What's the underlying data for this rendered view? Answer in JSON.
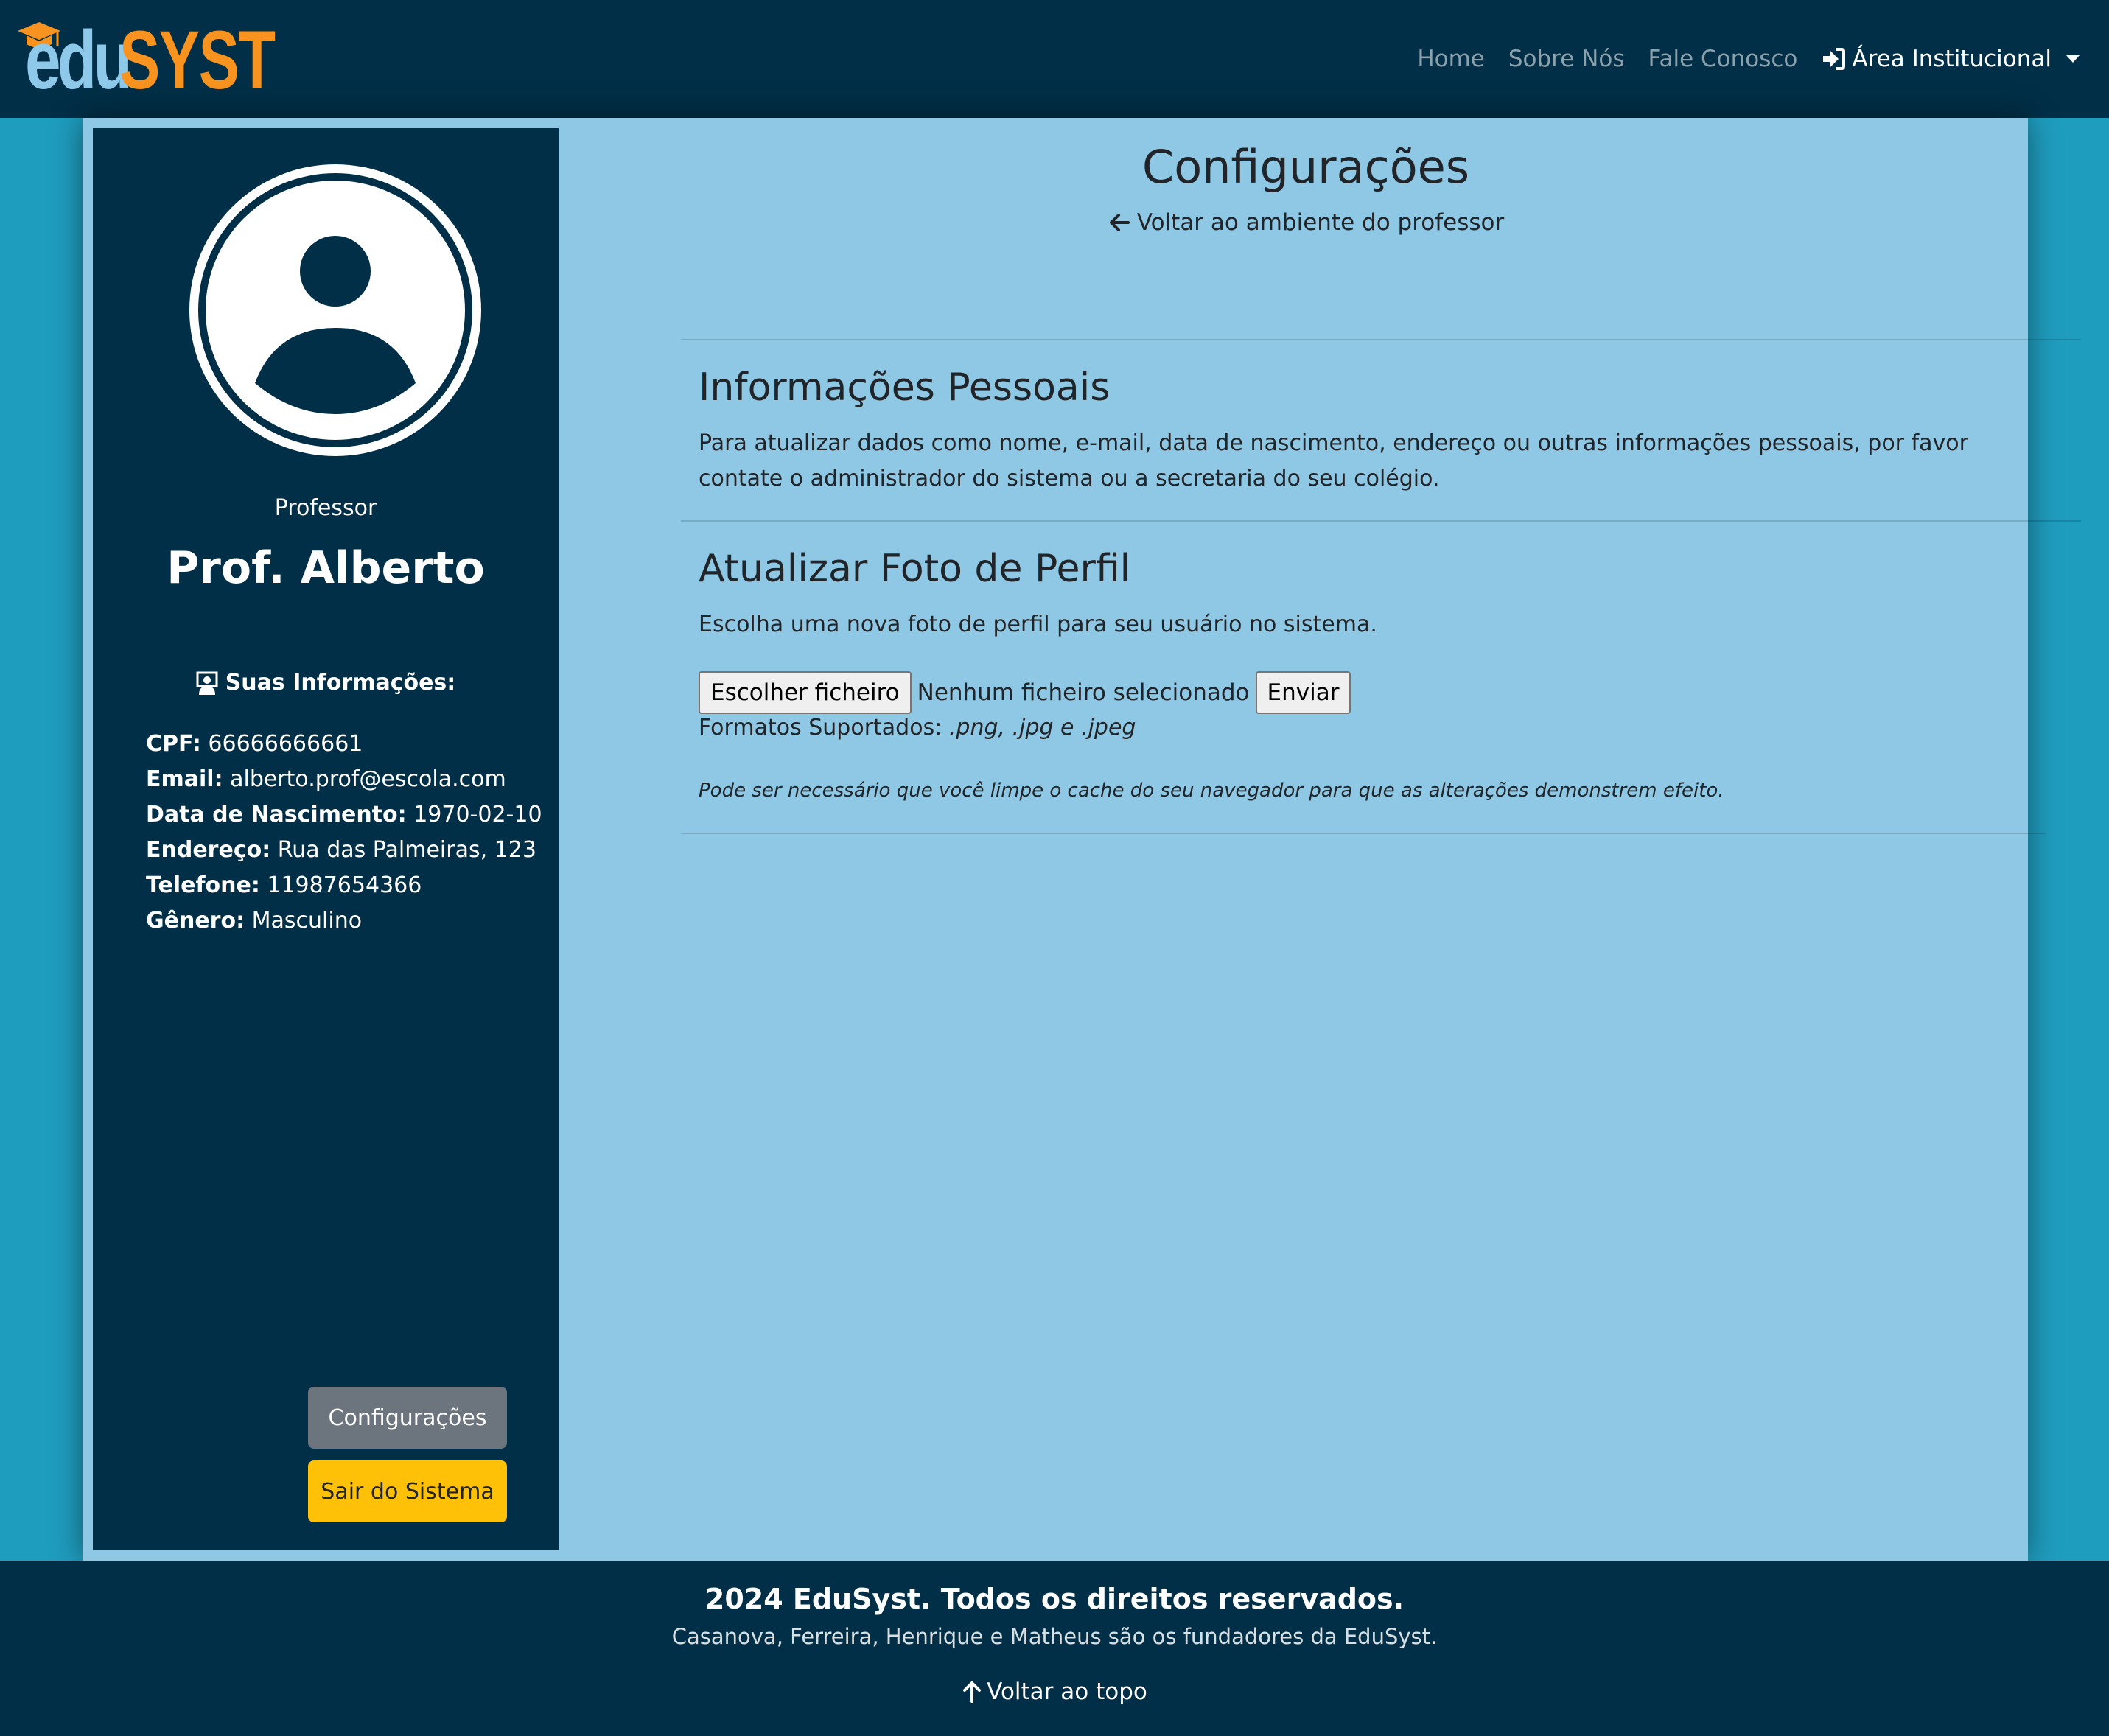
{
  "brand": {
    "part1": "edu",
    "part2": "SYST"
  },
  "nav": {
    "home": "Home",
    "about": "Sobre Nós",
    "contact": "Fale Conosco",
    "institutional": "Área Institucional"
  },
  "sidebar": {
    "role": "Professor",
    "name": "Prof. Alberto",
    "info_title": "Suas Informações:",
    "info": [
      {
        "label": "CPF:",
        "value": "66666666661"
      },
      {
        "label": "Email:",
        "value": "alberto.prof@escola.com"
      },
      {
        "label": "Data de Nascimento:",
        "value": "1970-02-10"
      },
      {
        "label": "Endereço:",
        "value": "Rua das Palmeiras, 123"
      },
      {
        "label": "Telefone:",
        "value": "11987654366"
      },
      {
        "label": "Gênero:",
        "value": "Masculino"
      }
    ],
    "config_button": "Configurações",
    "exit_button": "Sair do Sistema"
  },
  "main": {
    "title": "Configurações",
    "back_link": "Voltar ao ambiente do professor",
    "personal": {
      "title": "Informações Pessoais",
      "text": "Para atualizar dados como nome, e-mail, data de nascimento, endereço ou outras informações pessoais, por favor contate o administrador do sistema ou a secretaria do seu colégio."
    },
    "photo": {
      "title": "Atualizar Foto de Perfil",
      "text": "Escolha uma nova foto de perfil para seu usuário no sistema.",
      "choose_button": "Escolher ficheiro",
      "no_file": "Nenhum ficheiro selecionado",
      "submit_button": "Enviar",
      "formats_label": "Formatos Suportados:",
      "formats_value": ".png, .jpg e .jpeg",
      "cache_note": "Pode ser necessário que você limpe o cache do seu navegador para que as alterações demonstrem efeito."
    }
  },
  "footer": {
    "title": "2024 EduSyst. Todos os direitos reservados.",
    "subtitle": "Casanova, Ferreira, Henrique e Matheus são os fundadores da EduSyst.",
    "back_to_top": "Voltar ao topo"
  },
  "colors": {
    "navbar": "#002f47",
    "page_bg": "#1f9dbf",
    "content_bg": "#8ec8e4",
    "logo_edu": "#8ec9ea",
    "logo_syst": "#f7931e",
    "btn_secondary": "#6c757d",
    "btn_warning": "#ffc107"
  },
  "icons": [
    "graduation-cap-icon",
    "login-icon",
    "caret-down-icon",
    "user-avatar-icon",
    "teacher-icon",
    "arrow-left-icon",
    "arrow-up-icon"
  ]
}
